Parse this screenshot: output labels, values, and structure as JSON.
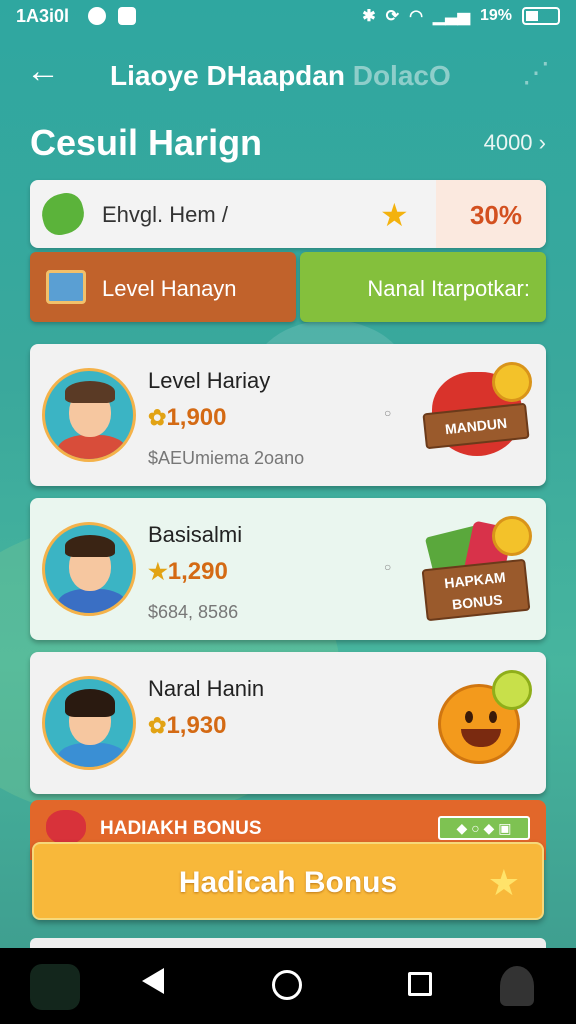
{
  "status_bar": {
    "time": "1A3i0l",
    "battery": "19%"
  },
  "header": {
    "title": "Liaoye DHaapdan",
    "title_faded": "DolacO"
  },
  "section": {
    "title": "Cesuil Harign",
    "count": "4000"
  },
  "level_card": {
    "label": "Ehvgl. Hem /",
    "percent": "30%"
  },
  "tabs": [
    {
      "label": "Level Hanayn"
    },
    {
      "label": "Nanal Itarpotkar:"
    }
  ],
  "entries": [
    {
      "name": "Level Hariay ",
      "score": "1,900",
      "sub": "$AEUmiema 2oano",
      "reward_label": "MANDUN",
      "reward_icon": "heart-reward-icon"
    },
    {
      "name": "Basisalmi",
      "score": "1,290",
      "sub": "$684, 8586",
      "reward_label_1": "HAPKAM",
      "reward_label_2": "BONUS",
      "reward_icon": "gift-reward-icon"
    },
    {
      "name": "Naral Hanin",
      "score": "1,930",
      "sub": "",
      "reward_icon": "smiley-reward-icon"
    }
  ],
  "bonus": {
    "banner_label": "HADIAKH BONUS",
    "badge": "◆ ○ ◆ ▣",
    "button_label": "Hadicah Bonus"
  },
  "colors": {
    "accent": "#2fa7a0",
    "orange": "#c1622b",
    "green": "#84c03c",
    "bonus": "#f8b83a"
  }
}
